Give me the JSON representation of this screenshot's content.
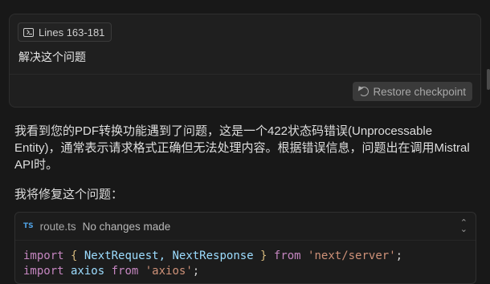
{
  "user_card": {
    "context_chip_label": "Lines 163-181",
    "message": "解决这个问题",
    "restore_label": "Restore checkpoint"
  },
  "assistant": {
    "paragraph1": "我看到您的PDF转换功能遇到了问题，这是一个422状态码错误(Unprocessable Entity)，通常表示请求格式正确但无法处理内容。根据错误信息，问题出在调用Mistral API时。",
    "paragraph2": "我将修复这个问题："
  },
  "code_block": {
    "lang_badge": "TS",
    "file_name": "route.ts",
    "status": "No changes made",
    "lines": [
      [
        "import",
        " ",
        "{",
        " NextRequest, NextResponse ",
        "}",
        " from ",
        "'next/server'",
        ";"
      ],
      [
        "import",
        " axios ",
        "from",
        " ",
        "'axios'",
        ";"
      ]
    ]
  }
}
